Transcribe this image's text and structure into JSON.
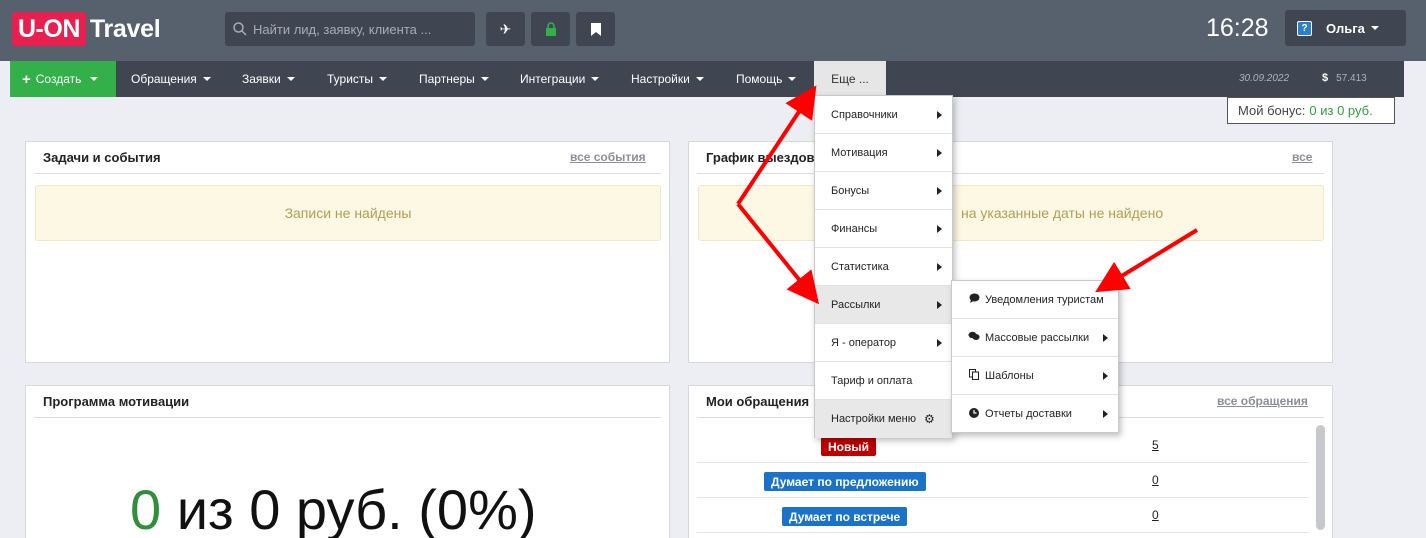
{
  "header": {
    "logo_main": "U-ON",
    "logo_sub": "Travel",
    "search_placeholder": "Найти лид, заявку, клиента ...",
    "time": "16:28",
    "user_name": "Ольга",
    "help_glyph": "?"
  },
  "nav": {
    "create": "Создать",
    "items": [
      "Обращения",
      "Заявки",
      "Туристы",
      "Партнеры",
      "Интеграции",
      "Настройки",
      "Помощь"
    ],
    "more": "Еще ...",
    "date": "30.09.2022",
    "currency_symbol": "$",
    "balance": "57.413"
  },
  "bonus": {
    "label": "Мой бонус:",
    "value": "0 из 0 руб."
  },
  "tasks_panel": {
    "title": "Задачи и события",
    "link": "все события",
    "empty": "Записи не найдены"
  },
  "schedule_panel": {
    "title": "График выездов",
    "link": "все",
    "empty": "на указанные даты не найдено"
  },
  "motivation_panel": {
    "title": "Программа мотивации",
    "value_zero": "0",
    "value_rest": " из 0 руб. (0%)"
  },
  "appeals_panel": {
    "title": "Мои обращения",
    "link": "все обращения",
    "rows": [
      {
        "status": "Новый",
        "count": "5",
        "color": "#c00000"
      },
      {
        "status": "Думает по предложению",
        "count": "0",
        "color": "#1a73c9"
      },
      {
        "status": "Думает по встрече",
        "count": "0",
        "color": "#1a73c9"
      }
    ]
  },
  "more_menu": {
    "items": [
      "Справочники",
      "Мотивация",
      "Бонусы",
      "Финансы",
      "Статистика",
      "Рассылки",
      "Я - оператор",
      "Тариф и оплата",
      "Настройки меню"
    ]
  },
  "mailing_submenu": {
    "items": [
      {
        "label": "Уведомления туристам",
        "icon": "comment-icon"
      },
      {
        "label": "Массовые рассылки",
        "icon": "comments-icon"
      },
      {
        "label": "Шаблоны",
        "icon": "copy-icon"
      },
      {
        "label": "Отчеты доставки",
        "icon": "clock-icon"
      }
    ]
  },
  "colors": {
    "topbar": "#57606d",
    "navbar": "#3f4652",
    "create": "#33b04a",
    "logo": "#e8204f",
    "arrow": "#ff0000"
  }
}
